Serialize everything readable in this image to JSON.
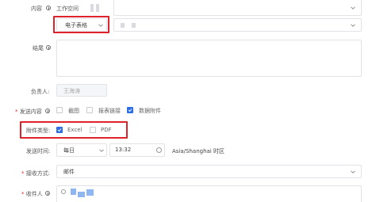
{
  "content_row": {
    "label": "内容",
    "value": "工作空间"
  },
  "type_select": {
    "value": "电子表格"
  },
  "note_row": {
    "label": "结尾"
  },
  "owner_row": {
    "label": "负责人:",
    "value": "王海涛"
  },
  "send_content_row": {
    "label": "发送内容",
    "options": [
      {
        "label": "截图",
        "checked": false
      },
      {
        "label": "报表链接",
        "checked": false
      },
      {
        "label": "数据附件",
        "checked": true
      }
    ]
  },
  "attachment_row": {
    "label": "附件类型:",
    "options": [
      {
        "label": "Excel",
        "checked": true
      },
      {
        "label": "PDF",
        "checked": false
      }
    ]
  },
  "send_time_row": {
    "label": "发送时间:",
    "frequency": "每日",
    "time": "13:32",
    "timezone": "Asia/Shanghai 时区"
  },
  "receive_row": {
    "label": "接收方式:",
    "value": "邮件"
  },
  "recipient_row": {
    "label": "收件人"
  },
  "colors": {
    "accent": "#2d6ee6",
    "highlight": "#e0232a",
    "border": "#e1e3e8"
  }
}
